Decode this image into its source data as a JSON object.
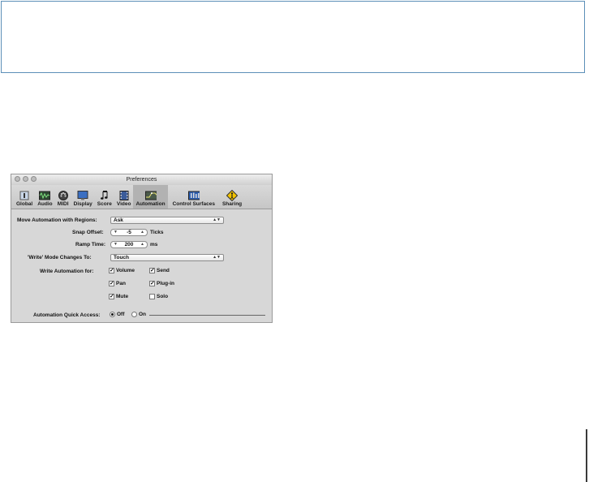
{
  "window": {
    "title": "Preferences"
  },
  "toolbar": {
    "items": [
      {
        "label": "Global",
        "icon": "global-icon"
      },
      {
        "label": "Audio",
        "icon": "audio-icon"
      },
      {
        "label": "MIDI",
        "icon": "midi-icon"
      },
      {
        "label": "Display",
        "icon": "display-icon"
      },
      {
        "label": "Score",
        "icon": "score-icon"
      },
      {
        "label": "Video",
        "icon": "video-icon"
      },
      {
        "label": "Automation",
        "icon": "automation-icon",
        "selected": true
      },
      {
        "label": "Control Surfaces",
        "icon": "control-surfaces-icon"
      },
      {
        "label": "Sharing",
        "icon": "sharing-icon"
      }
    ]
  },
  "automation": {
    "move_label": "Move Automation with Regions:",
    "move_value": "Ask",
    "snap_label": "Snap Offset:",
    "snap_value": "-5",
    "snap_unit": "Ticks",
    "ramp_label": "Ramp Time:",
    "ramp_value": "200",
    "ramp_unit": "ms",
    "write_mode_label": "'Write' Mode Changes To:",
    "write_mode_value": "Touch",
    "write_for_label": "Write Automation for:",
    "checkboxes": [
      {
        "label": "Volume",
        "checked": true
      },
      {
        "label": "Send",
        "checked": true
      },
      {
        "label": "Pan",
        "checked": true
      },
      {
        "label": "Plug-in",
        "checked": true
      },
      {
        "label": "Mute",
        "checked": true
      },
      {
        "label": "Solo",
        "checked": false
      }
    ],
    "quick_access_label": "Automation Quick Access:",
    "quick_off": "Off",
    "quick_on": "On",
    "quick_selected": "Off"
  },
  "colors": {
    "frame_border": "#5c8fb8",
    "window_bg": "#d7d7d7",
    "accent_selected": "#b2b2b2"
  }
}
